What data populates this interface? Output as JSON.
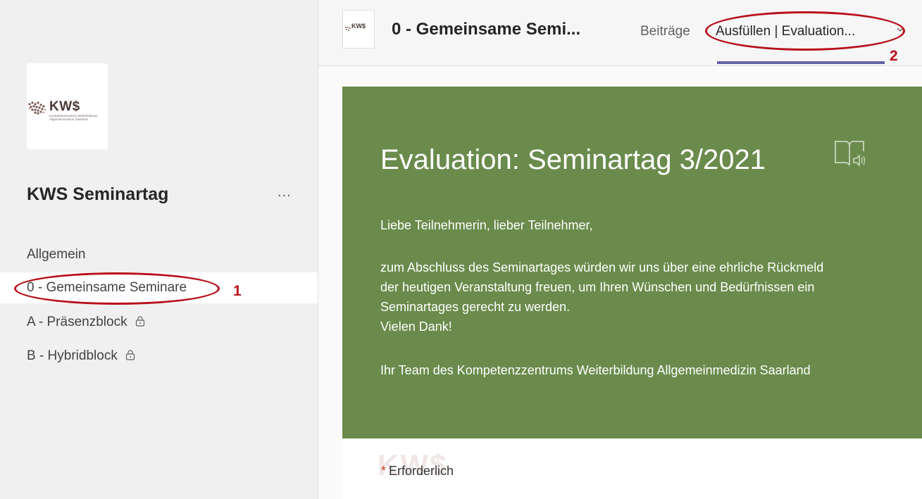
{
  "sidebar": {
    "team_logo": {
      "name": "KW$",
      "subtitle": "Kompetenzzentrum Weiterbildung Allgemeinmedizin Saarland"
    },
    "team_name": "KWS Seminartag",
    "more_label": "...",
    "channels": [
      {
        "label": "Allgemein",
        "locked": false,
        "active": false
      },
      {
        "label": "0 - Gemeinsame Seminare",
        "locked": false,
        "active": true
      },
      {
        "label": "A - Präsenzblock",
        "locked": true,
        "active": false
      },
      {
        "label": "B - Hybridblock",
        "locked": true,
        "active": false
      }
    ]
  },
  "header": {
    "logo_text": "KW$",
    "channel_title": "0 - Gemeinsame Semi...",
    "tabs": [
      {
        "label": "Beiträge",
        "active": false
      },
      {
        "label": "Ausfüllen | Evaluation...",
        "active": true
      }
    ]
  },
  "form": {
    "title": "Evaluation: Seminartag 3/2021",
    "greeting": "Liebe Teilnehmerin, lieber Teilnehmer,",
    "body_lines": [
      "zum Abschluss des Seminartages würden wir uns über eine ehrliche Rückmeld",
      "der heutigen Veranstaltung freuen, um Ihren Wünschen und Bedürfnissen ein",
      "Seminartages gerecht zu werden.",
      "Vielen Dank!"
    ],
    "signature": "Ihr Team des Kompetenzzentrums Weiterbildung Allgemeinmedizin Saarland",
    "required_star": "*",
    "required_label": "Erforderlich",
    "faint_logo": "KW$"
  },
  "annotations": {
    "one": "1",
    "two": "2"
  },
  "colors": {
    "banner": "#6a8b4c",
    "annotation": "#b8111b",
    "tab_underline": "#6264a7",
    "sidebar_bg": "#f0f0f0"
  },
  "icons": [
    "kws-logo-icon",
    "more-icon",
    "lock-icon",
    "chevron-down-icon",
    "immersive-reader-icon"
  ]
}
